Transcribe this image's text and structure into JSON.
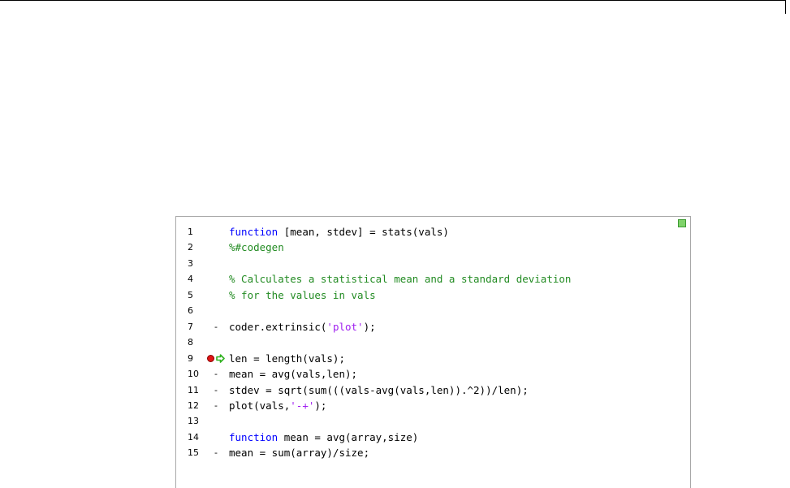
{
  "editor": {
    "lines": [
      {
        "num": "1",
        "dash": "",
        "segments": [
          {
            "t": "kw",
            "v": "function"
          },
          {
            "t": "n",
            "v": " [mean, stdev] = stats(vals)"
          }
        ]
      },
      {
        "num": "2",
        "dash": "",
        "segments": [
          {
            "t": "cm",
            "v": "%#codegen"
          }
        ]
      },
      {
        "num": "3",
        "dash": "",
        "segments": []
      },
      {
        "num": "4",
        "dash": "",
        "segments": [
          {
            "t": "cm",
            "v": "% Calculates a statistical mean and a standard deviation"
          }
        ]
      },
      {
        "num": "5",
        "dash": "",
        "segments": [
          {
            "t": "cm",
            "v": "% for the values in vals"
          }
        ]
      },
      {
        "num": "6",
        "dash": "",
        "segments": []
      },
      {
        "num": "7",
        "dash": "-",
        "segments": [
          {
            "t": "n",
            "v": "coder.extrinsic("
          },
          {
            "t": "str",
            "v": "'plot'"
          },
          {
            "t": "n",
            "v": ");"
          }
        ]
      },
      {
        "num": "8",
        "dash": "",
        "segments": []
      },
      {
        "num": "9",
        "dash": "",
        "breakpoint": true,
        "current": true,
        "segments": [
          {
            "t": "n",
            "v": "len = length(vals);"
          }
        ]
      },
      {
        "num": "10",
        "dash": "-",
        "segments": [
          {
            "t": "n",
            "v": "mean = avg(vals,len);"
          }
        ]
      },
      {
        "num": "11",
        "dash": "-",
        "segments": [
          {
            "t": "n",
            "v": "stdev = sqrt(sum(((vals-avg(vals,len)).^2))/len);"
          }
        ]
      },
      {
        "num": "12",
        "dash": "-",
        "segments": [
          {
            "t": "n",
            "v": "plot(vals,"
          },
          {
            "t": "str",
            "v": "'-+'"
          },
          {
            "t": "n",
            "v": ");"
          }
        ]
      },
      {
        "num": "13",
        "dash": "",
        "segments": []
      },
      {
        "num": "14",
        "dash": "",
        "segments": [
          {
            "t": "kw",
            "v": "function"
          },
          {
            "t": "n",
            "v": " mean = avg(array,size)"
          }
        ]
      },
      {
        "num": "15",
        "dash": "-",
        "segments": [
          {
            "t": "n",
            "v": "mean = sum(array)/size;"
          }
        ]
      }
    ],
    "status_indicator_color": "#7fd36a",
    "breakpoint_color": "#e01616",
    "current_line_arrow_color": "#2fb11f",
    "keyword_color": "#0000ff",
    "comment_color": "#228b22",
    "string_color": "#a020f0"
  }
}
